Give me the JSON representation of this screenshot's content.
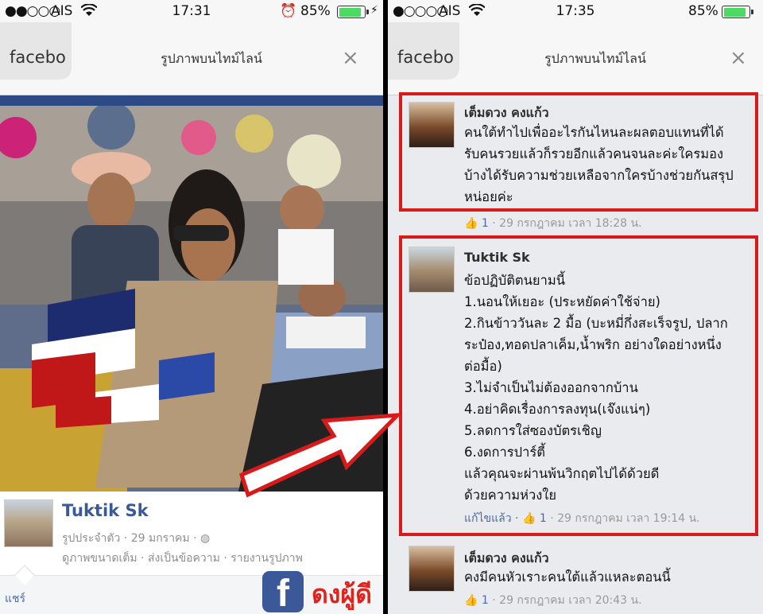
{
  "left": {
    "status": {
      "carrier": "AIS",
      "time": "17:31",
      "battery": "85%"
    },
    "nav": {
      "back_tab": "facebo",
      "title": "รูปภาพบนไทม์ไลน์",
      "close": "×"
    },
    "post": {
      "name": "Tuktik Sk",
      "meta": "รูปประจำตัว · 29 มกราคม ·",
      "actions": "ดูภาพขนาดเต็ม · ส่งเป็นข้อความ · รายงานรูปภาพ",
      "share": "แชร์"
    },
    "brand": {
      "logo_letter": "f",
      "text": "ดงผู้ดี"
    }
  },
  "right": {
    "status": {
      "carrier": "AIS",
      "time": "17:35",
      "battery": "85%"
    },
    "nav": {
      "back_tab": "facebo",
      "title": "รูปภาพบนไทม์ไลน์",
      "close": "×"
    },
    "comments": [
      {
        "name": "เต็มดวง คงแก้ว",
        "lines": [
          "คนใต้ทำไปเพื่ออะไรกันไหนละผลตอบแทนที่ได้",
          "รับคนรวยแล้วก็รวยอีกแล้วคนจนละค่ะใครมอง",
          "บ้างได้รับความช่วยเหลือจากใครบ้างช่วยกันสรุป",
          "หน่อยค่ะ"
        ],
        "likes": "1",
        "time": "· 29 กรกฎาคม เวลา 18:28 น."
      },
      {
        "name": "Tuktik Sk",
        "lines": [
          "ข้อปฏิบัติตนยามนี้",
          "1.นอนให้เยอะ (ประหยัดค่าใช้จ่าย)",
          "2.กินข้าววันละ 2 มื้อ (บะหมี่กึ่งสะเร็จรูป, ปลาก",
          "ระป๋อง,ทอดปลาเค็ม,น้ำพริก อย่างใดอย่างหนึ่ง",
          "ต่อมื้อ)",
          "3.ไม่จำเป็นไม่ต้องออกจากบ้าน",
          "4.อย่าคิดเรื่องการลงทุน(เจ๊งแน่ๆ)",
          "5.ลดการใส่ซองบัตรเชิญ",
          "6.งดการปาร์ตี้",
          "แล้วคุณจะผ่านพ้นวิกฤตไปได้ด้วยดี",
          "ด้วยความห่วงใย"
        ],
        "edited": "แก้ไขแล้ว ·",
        "likes": "1",
        "time": "· 29 กรกฎาคม เวลา 19:14 น."
      },
      {
        "name": "เต็มดวง คงแก้ว",
        "lines": [
          "คงมีคนหัวเราะคนใต้แล้วแหละตอนนี้"
        ],
        "likes": "1",
        "time": "· 29 กรกฎาคม เวลา 20:43 น."
      }
    ]
  },
  "colors": {
    "accent": "#3b5998",
    "highlight": "#d81a1a",
    "battery": "#4cd964"
  }
}
